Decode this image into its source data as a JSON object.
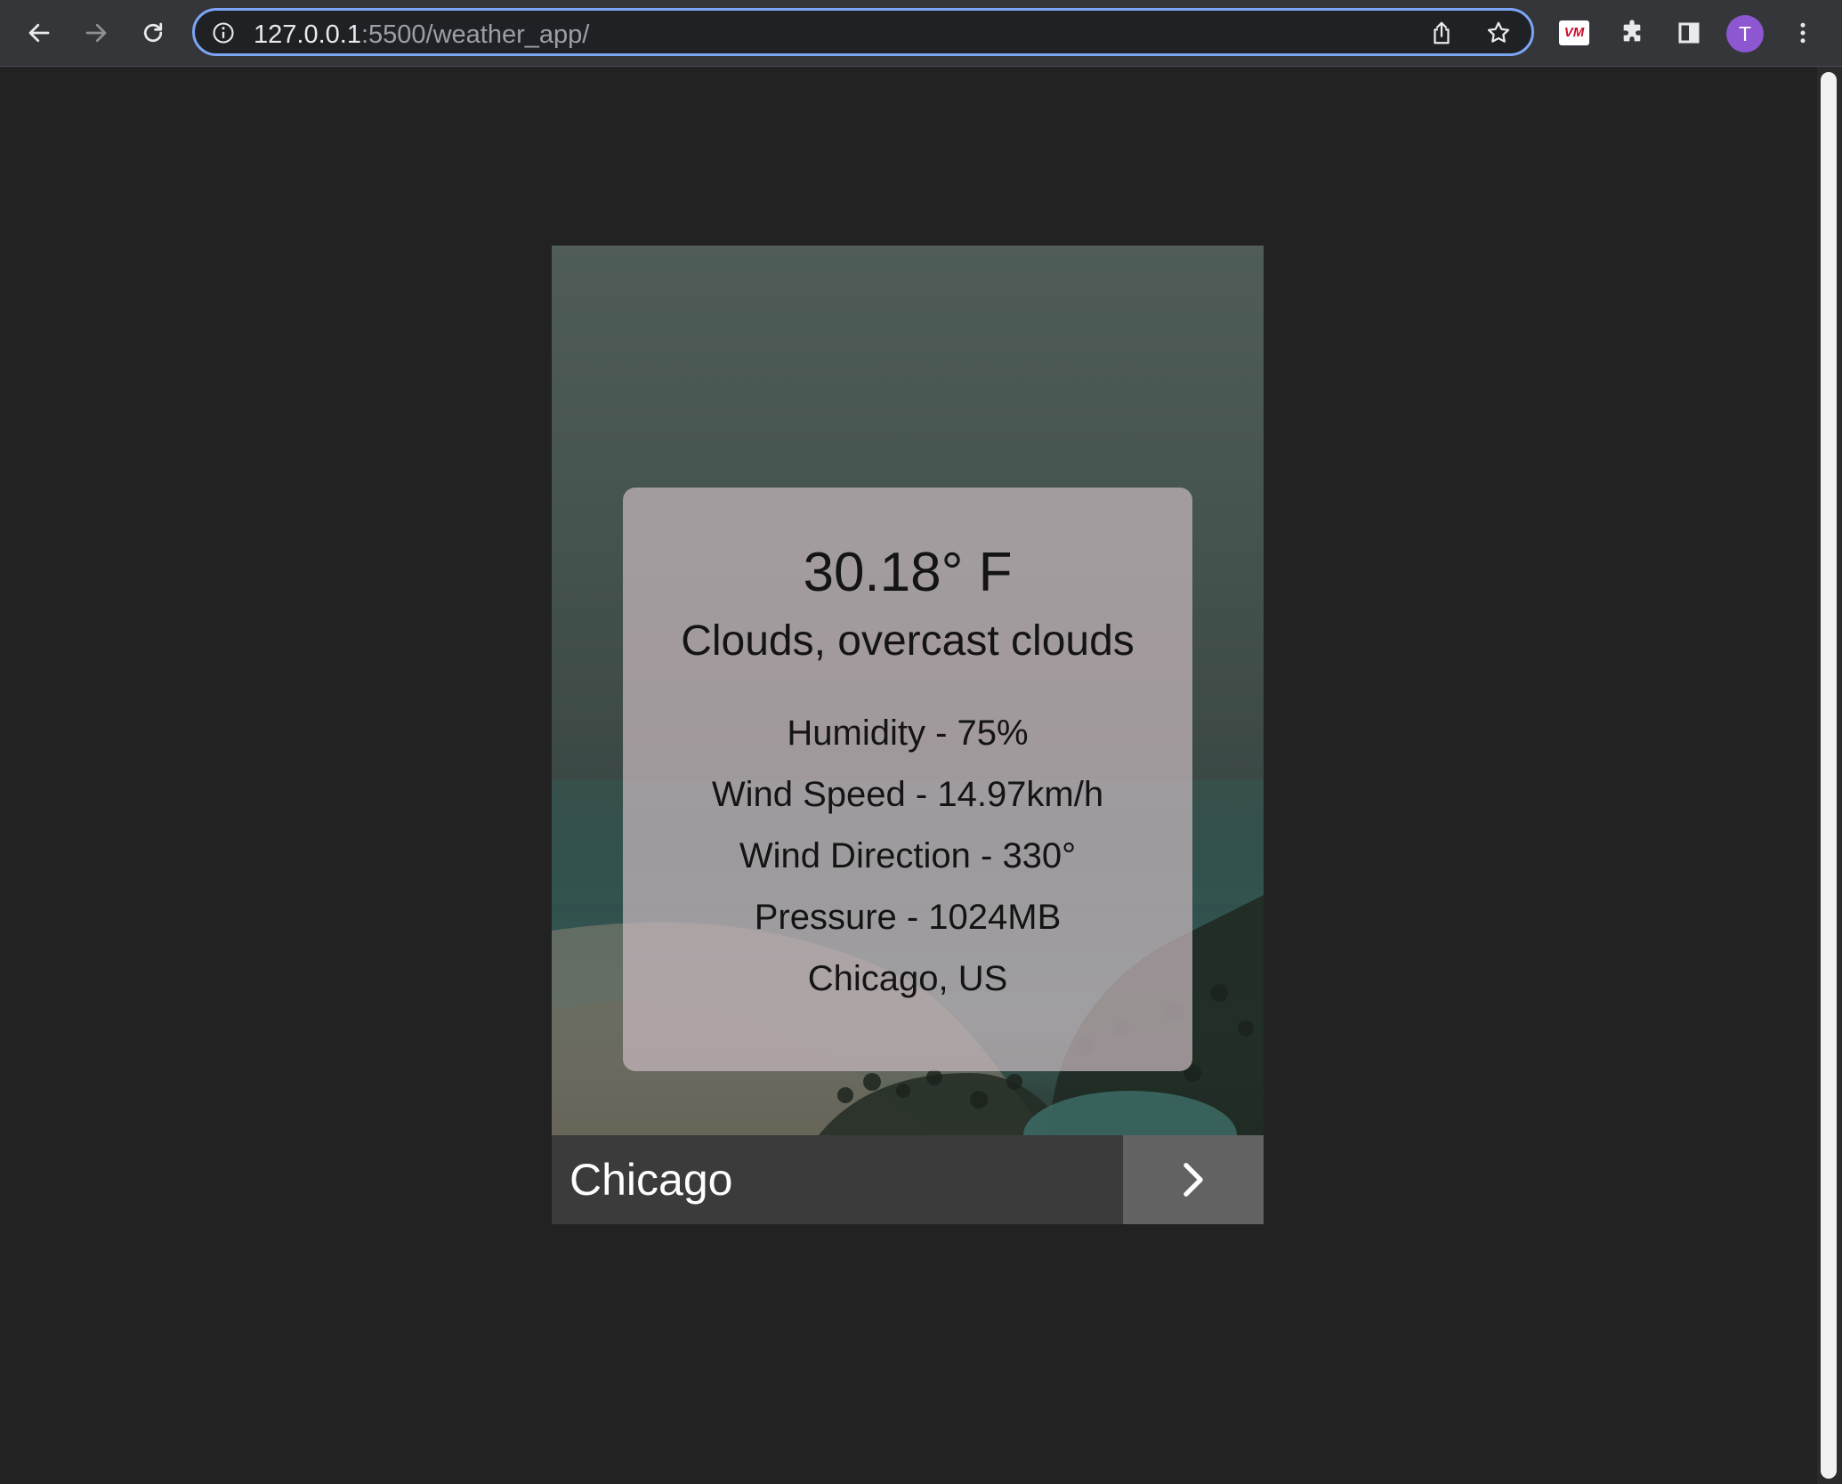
{
  "browser": {
    "url_host": "127.0.0.1",
    "url_path": ":5500/weather_app/",
    "profile_initial": "T",
    "extension_badge": "VM"
  },
  "weather": {
    "temperature": "30.18° F",
    "description": "Clouds, overcast clouds",
    "humidity": "Humidity - 75%",
    "wind_speed": "Wind Speed - 14.97km/h",
    "wind_direction": "Wind Direction - 330°",
    "pressure": "Pressure - 1024MB",
    "location": "Chicago, US"
  },
  "city_bar": {
    "city": "Chicago",
    "next_icon": "chevron-right-icon"
  },
  "colors": {
    "page_bg": "#222222",
    "toolbar_bg": "#35363a",
    "omnibox_focus_ring": "#7aa6f5",
    "avatar": "#8c57d0",
    "info_panel": "#c8b9be",
    "city_bar": "#3b3b3b",
    "next_button": "#626262"
  }
}
